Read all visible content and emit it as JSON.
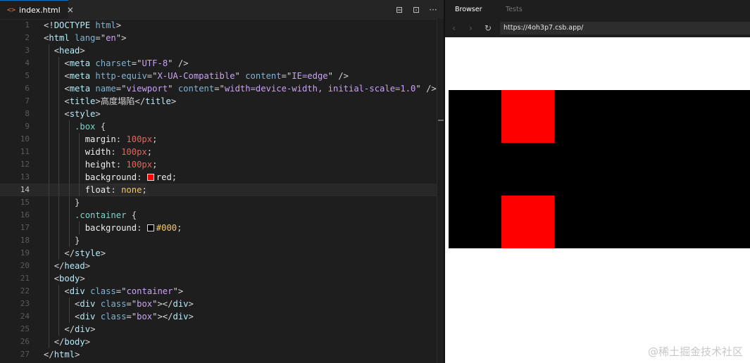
{
  "editor": {
    "tab_label": "index.html",
    "tab_icon": "<>",
    "tab_close": "×",
    "actions": [
      "⊟",
      "⊡",
      "···"
    ],
    "lines": [
      {
        "n": "1",
        "html": "<span class='pn'>&lt;!</span><span class='tg'>DOCTYPE</span> <span class='an'>html</span><span class='pn'>&gt;</span>"
      },
      {
        "n": "2",
        "html": "<span class='pn'>&lt;</span><span class='tg'>html</span> <span class='an'>lang</span><span class='pn'>=\"</span><span class='av'>en</span><span class='pn'>\"&gt;</span>"
      },
      {
        "n": "3",
        "html": "  <span class='pn'>&lt;</span><span class='tg'>head</span><span class='pn'>&gt;</span>"
      },
      {
        "n": "4",
        "html": "    <span class='pn'>&lt;</span><span class='tg'>meta</span> <span class='an'>charset</span><span class='pn'>=\"</span><span class='av'>UTF-8</span><span class='pn'>\" /&gt;</span>"
      },
      {
        "n": "5",
        "html": "    <span class='pn'>&lt;</span><span class='tg'>meta</span> <span class='an'>http-equiv</span><span class='pn'>=\"</span><span class='av'>X-UA-Compatible</span><span class='pn'>\" </span><span class='an'>content</span><span class='pn'>=\"</span><span class='av'>IE=edge</span><span class='pn'>\" /&gt;</span>"
      },
      {
        "n": "6",
        "html": "    <span class='pn'>&lt;</span><span class='tg'>meta</span> <span class='an'>name</span><span class='pn'>=\"</span><span class='av'>viewport</span><span class='pn'>\" </span><span class='an'>content</span><span class='pn'>=\"</span><span class='av'>width=device-width, initial-scale=1.0</span><span class='pn'>\" /&gt;</span>"
      },
      {
        "n": "7",
        "html": "    <span class='pn'>&lt;</span><span class='tg'>title</span><span class='pn'>&gt;</span><span class='pn'>高度塌陷</span><span class='pn'>&lt;/</span><span class='tg'>title</span><span class='pn'>&gt;</span>"
      },
      {
        "n": "8",
        "html": "    <span class='pn'>&lt;</span><span class='tg'>style</span><span class='pn'>&gt;</span>"
      },
      {
        "n": "9",
        "html": "      <span class='sel'>.box</span> <span class='pn'>{</span>"
      },
      {
        "n": "10",
        "html": "        <span class='prop'>margin</span><span class='pn'>: </span><span class='num'>100px</span><span class='pn'>;</span>"
      },
      {
        "n": "11",
        "html": "        <span class='prop'>width</span><span class='pn'>: </span><span class='num'>100px</span><span class='pn'>;</span>"
      },
      {
        "n": "12",
        "html": "        <span class='prop'>height</span><span class='pn'>: </span><span class='num'>100px</span><span class='pn'>;</span>"
      },
      {
        "n": "13",
        "html": "        <span class='prop'>background</span><span class='pn'>: </span><span class='swatch' style='background:#ff0000'></span><span class='red'>red</span><span class='pn'>;</span>"
      },
      {
        "n": "14",
        "html": "        <span class='prop'>float</span><span class='pn'>: </span><span class='kw'>none</span><span class='pn'>;</span>",
        "active": true
      },
      {
        "n": "15",
        "html": "      <span class='pn'>}</span>"
      },
      {
        "n": "16",
        "html": "      <span class='sel'>.container</span> <span class='pn'>{</span>"
      },
      {
        "n": "17",
        "html": "        <span class='prop'>background</span><span class='pn'>: </span><span class='swatch' style='background:#000000'></span><span class='kw'>#000</span><span class='pn'>;</span>"
      },
      {
        "n": "18",
        "html": "      <span class='pn'>}</span>"
      },
      {
        "n": "19",
        "html": "    <span class='pn'>&lt;/</span><span class='tg'>style</span><span class='pn'>&gt;</span>"
      },
      {
        "n": "20",
        "html": "  <span class='pn'>&lt;/</span><span class='tg'>head</span><span class='pn'>&gt;</span>"
      },
      {
        "n": "21",
        "html": "  <span class='pn'>&lt;</span><span class='tg'>body</span><span class='pn'>&gt;</span>"
      },
      {
        "n": "22",
        "html": "    <span class='pn'>&lt;</span><span class='tg'>div</span> <span class='an'>class</span><span class='pn'>=\"</span><span class='av'>container</span><span class='pn'>\"&gt;</span>"
      },
      {
        "n": "23",
        "html": "      <span class='pn'>&lt;</span><span class='tg'>div</span> <span class='an'>class</span><span class='pn'>=\"</span><span class='av'>box</span><span class='pn'>\"&gt;&lt;/</span><span class='tg'>div</span><span class='pn'>&gt;</span>"
      },
      {
        "n": "24",
        "html": "      <span class='pn'>&lt;</span><span class='tg'>div</span> <span class='an'>class</span><span class='pn'>=\"</span><span class='av'>box</span><span class='pn'>\"&gt;&lt;/</span><span class='tg'>div</span><span class='pn'>&gt;</span>"
      },
      {
        "n": "25",
        "html": "    <span class='pn'>&lt;/</span><span class='tg'>div</span><span class='pn'>&gt;</span>"
      },
      {
        "n": "26",
        "html": "  <span class='pn'>&lt;/</span><span class='tg'>body</span><span class='pn'>&gt;</span>"
      },
      {
        "n": "27",
        "html": "<span class='pn'>&lt;/</span><span class='tg'>html</span><span class='pn'>&gt;</span>"
      }
    ]
  },
  "browser": {
    "tabs": [
      "Browser",
      "Tests"
    ],
    "nav_back": "‹",
    "nav_forward": "›",
    "nav_reload": "↻",
    "url": "https://4oh3p7.csb.app/",
    "container_color": "#000000",
    "box_color": "#ff0000",
    "watermark": "@稀土掘金技术社区"
  }
}
